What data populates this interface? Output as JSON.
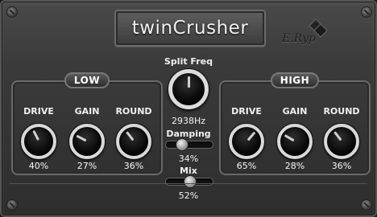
{
  "plugin": {
    "title": "twinCrusher",
    "brand": "E.Ryp"
  },
  "center": {
    "split_freq": {
      "label": "Split Freq",
      "value": "2938Hz",
      "level": 0.5
    },
    "damping": {
      "label": "Damping",
      "value": "34%",
      "level": 0.34
    },
    "mix": {
      "label": "Mix",
      "value": "52%",
      "level": 0.52
    }
  },
  "low": {
    "title": "LOW",
    "knobs": [
      {
        "label": "DRIVE",
        "value": "40%",
        "level": 0.4
      },
      {
        "label": "GAIN",
        "value": "27%",
        "level": 0.27
      },
      {
        "label": "ROUND",
        "value": "36%",
        "level": 0.36
      }
    ]
  },
  "high": {
    "title": "HIGH",
    "knobs": [
      {
        "label": "DRIVE",
        "value": "65%",
        "level": 0.65
      },
      {
        "label": "GAIN",
        "value": "28%",
        "level": 0.28
      },
      {
        "label": "ROUND",
        "value": "36%",
        "level": 0.36
      }
    ]
  },
  "icons": [
    "screw-icon",
    "logo-icon"
  ]
}
